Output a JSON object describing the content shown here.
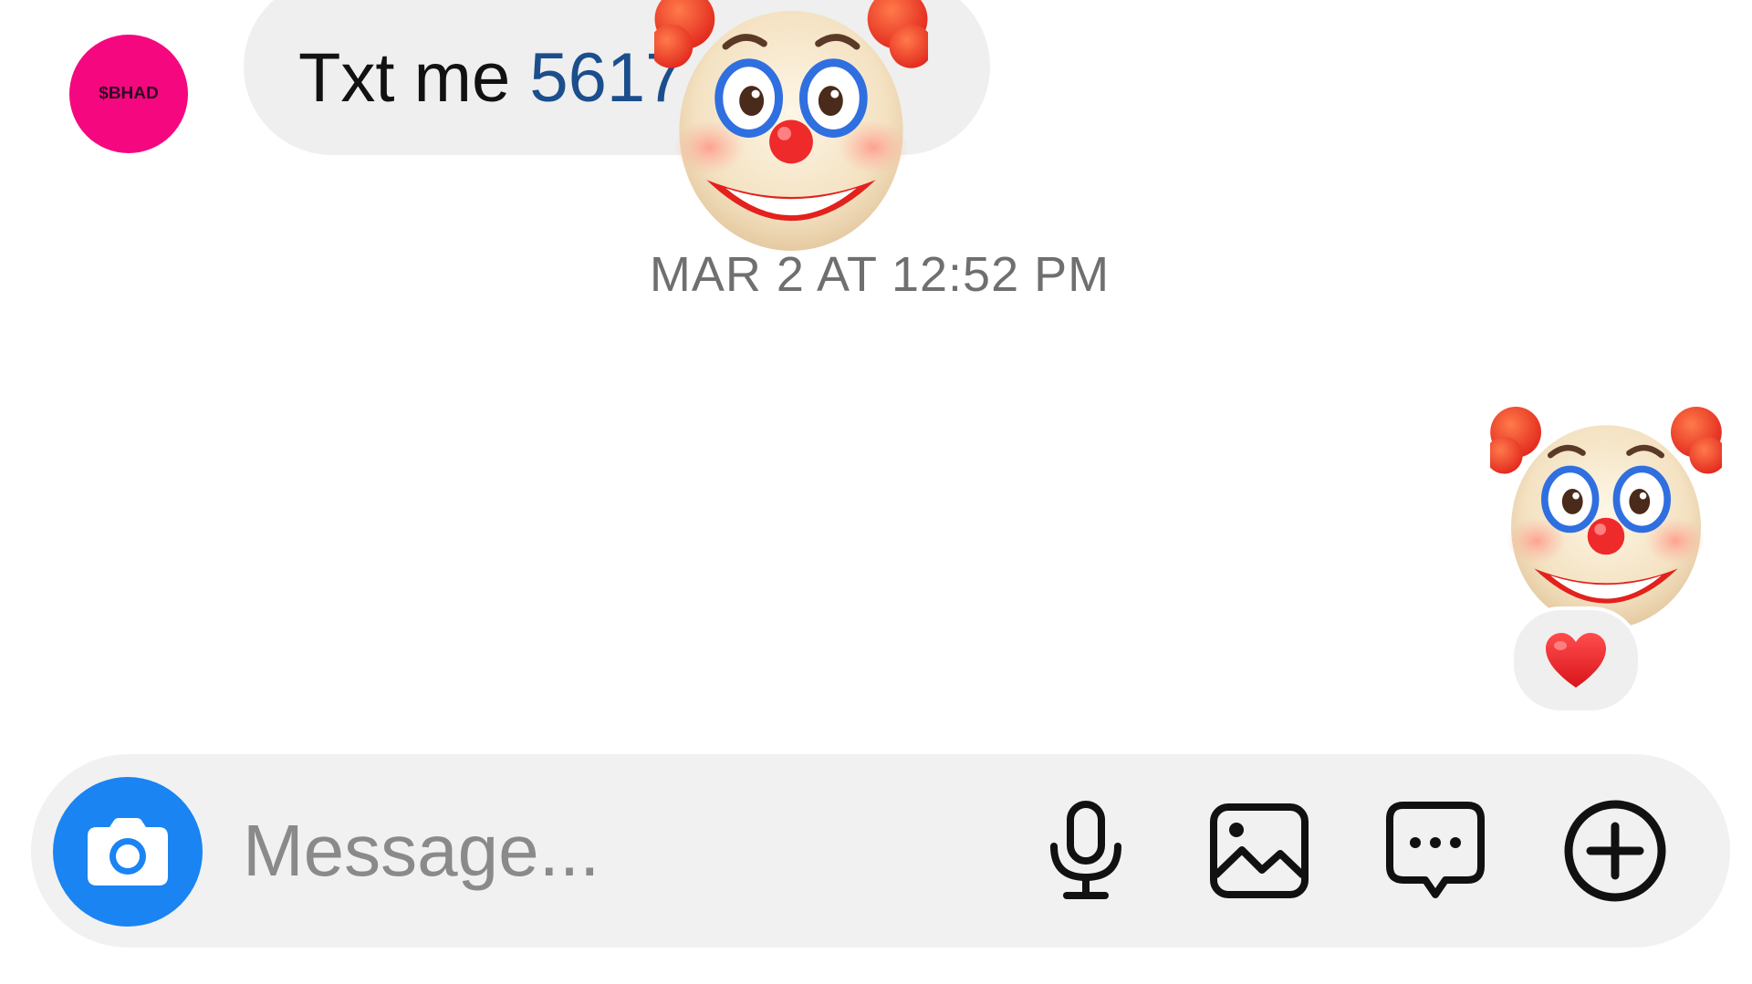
{
  "conversation": {
    "incoming_message": {
      "avatar_label": "$BHAD",
      "text_prefix": "Txt me ",
      "phone_visible": "5617",
      "reaction_emoji_icon": "clown-face-icon"
    },
    "timestamp": "MAR 2 AT 12:52 PM",
    "outgoing_message": {
      "emoji_icon": "clown-face-icon",
      "reaction_icon": "red-heart-icon"
    }
  },
  "composer": {
    "placeholder": "Message...",
    "value": "",
    "camera_icon": "camera-icon",
    "microphone_icon": "microphone-icon",
    "gallery_icon": "gallery-icon",
    "sticker_icon": "chat-bubble-ellipsis-icon",
    "add_icon": "plus-circle-icon"
  },
  "colors": {
    "avatar_bg": "#f5077f",
    "bubble_bg": "#efefef",
    "phone_link": "#1b4e8c",
    "timestamp_text": "#6f6f6f",
    "camera_button": "#1a84f2",
    "composer_bg": "#f1f1f1"
  }
}
